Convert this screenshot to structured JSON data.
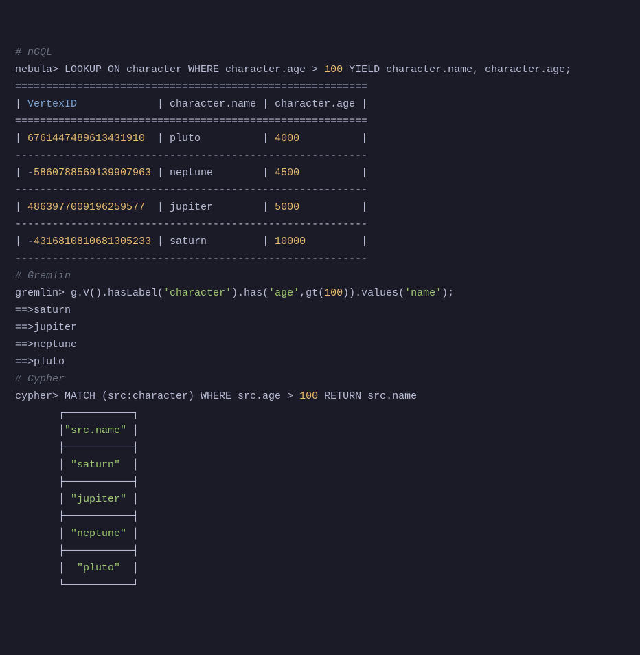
{
  "ngql": {
    "comment": "# nGQL",
    "prompt": "nebula> ",
    "query_before": "LOOKUP ON character WHERE character.age > ",
    "query_value": "100",
    "query_after": " YIELD character.name, character.age;",
    "divider_eq": "=========================================================",
    "header_row": {
      "pipe1": "| ",
      "vertex_id": "VertexID",
      "rest": "             | character.name | character.age |"
    },
    "divider_dash": "---------------------------------------------------------",
    "rows": [
      {
        "pre": "| ",
        "id": "6761447489613431910",
        "mid": "  | pluto          | ",
        "age": "4000",
        "end": "          |"
      },
      {
        "pre": "| -",
        "id": "5860788569139907963",
        "mid": " | neptune        | ",
        "age": "4500",
        "end": "          |"
      },
      {
        "pre": "| ",
        "id": "4863977009196259577",
        "mid": "  | jupiter        | ",
        "age": "5000",
        "end": "          |"
      },
      {
        "pre": "| -",
        "id": "4316810810681305233",
        "mid": " | saturn         | ",
        "age": "10000",
        "end": "         |"
      }
    ]
  },
  "gremlin": {
    "comment": "# Gremlin",
    "prompt": "gremlin> g.V().hasLabel(",
    "s1": "'character'",
    "m1": ").has(",
    "s2": "'age'",
    "m2": ",gt(",
    "n1": "100",
    "m3": ")).values(",
    "s3": "'name'",
    "end": ");",
    "results": [
      "==>saturn",
      "==>jupiter",
      "==>neptune",
      "==>pluto"
    ]
  },
  "cypher": {
    "comment": "# Cypher",
    "prompt": "cypher> MATCH (src:character) WHERE src.age > ",
    "value": "100",
    "rest": " RETURN src.name",
    "indent": "       ",
    "box_top": "┌───────────┐",
    "header_pipe1": "│",
    "header_val": "\"src.name\"",
    "header_pipe2": " │",
    "box_mid": "├───────────┤",
    "rows": [
      {
        "p1": "│ ",
        "v": "\"saturn\"",
        "p2": "  │"
      },
      {
        "p1": "│ ",
        "v": "\"jupiter\"",
        "p2": " │"
      },
      {
        "p1": "│ ",
        "v": "\"neptune\"",
        "p2": " │"
      },
      {
        "p1": "│  ",
        "v": "\"pluto\"",
        "p2": "  │"
      }
    ],
    "box_btm": "└───────────┘"
  }
}
